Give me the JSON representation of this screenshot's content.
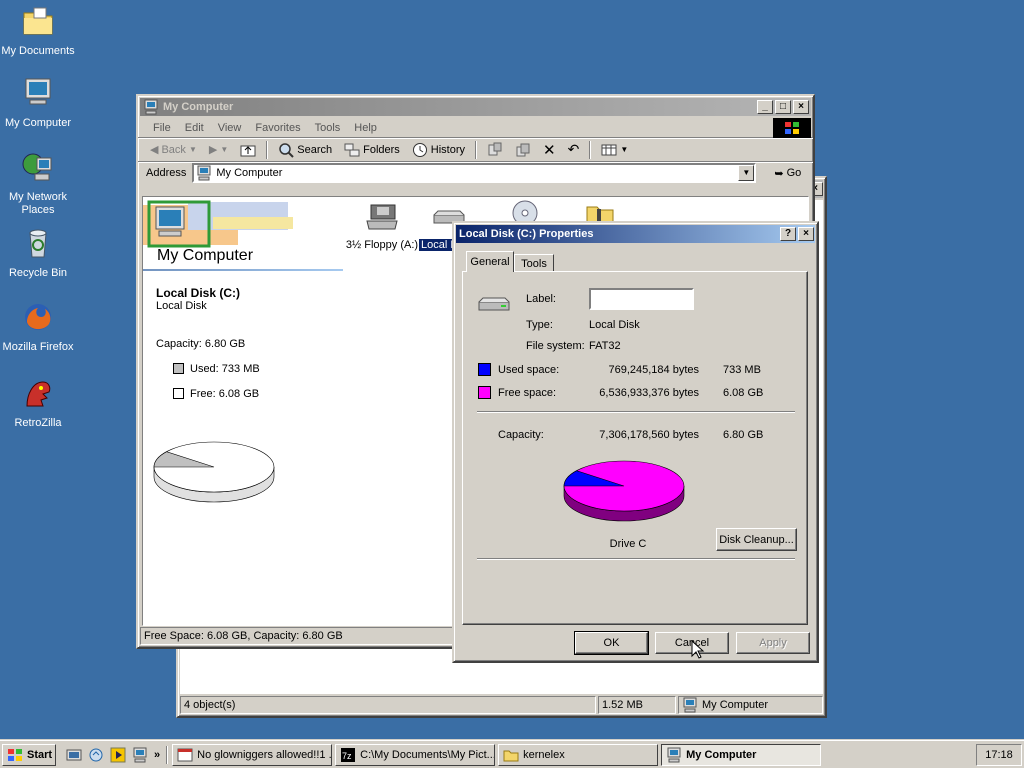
{
  "desktop": {
    "icons": [
      {
        "label": "My Documents"
      },
      {
        "label": "My Computer"
      },
      {
        "label": "My Network Places"
      },
      {
        "label": "Recycle Bin"
      },
      {
        "label": "Mozilla Firefox"
      },
      {
        "label": "RetroZilla"
      }
    ]
  },
  "explorer": {
    "title": "My Computer",
    "menu": [
      "File",
      "Edit",
      "View",
      "Favorites",
      "Tools",
      "Help"
    ],
    "toolbar": {
      "back": "Back",
      "search": "Search",
      "folders": "Folders",
      "history": "History"
    },
    "address_label": "Address",
    "address_value": "My Computer",
    "go": "Go",
    "side": {
      "heading": "My Computer",
      "drive_name": "Local Disk (C:)",
      "drive_type": "Local Disk",
      "capacity": "Capacity: 6.80 GB",
      "used": "Used: 733 MB",
      "free": "Free: 6.08 GB"
    },
    "items": [
      {
        "label": "3½ Floppy (A:)"
      },
      {
        "label": "Local D"
      }
    ],
    "status": "Free Space: 6.08 GB, Capacity: 6.80 GB"
  },
  "back_window": {
    "status": [
      "4 object(s)",
      "1.52 MB",
      "My Computer"
    ]
  },
  "dialog": {
    "title": "Local Disk (C:) Properties",
    "tabs": [
      "General",
      "Tools"
    ],
    "label_caption": "Label:",
    "label_value": "",
    "type_caption": "Type:",
    "type_value": "Local Disk",
    "fs_caption": "File system:",
    "fs_value": "FAT32",
    "used_caption": "Used space:",
    "used_bytes": "769,245,184 bytes",
    "used_size": "733 MB",
    "free_caption": "Free space:",
    "free_bytes": "6,536,933,376 bytes",
    "free_size": "6.08 GB",
    "capacity_caption": "Capacity:",
    "capacity_bytes": "7,306,178,560 bytes",
    "capacity_size": "6.80 GB",
    "drive_label": "Drive C",
    "cleanup": "Disk Cleanup...",
    "ok": "OK",
    "cancel": "Cancel",
    "apply": "Apply",
    "used_fraction": 0.105,
    "colors": {
      "used": "#0000ff",
      "free": "#ff00ff"
    }
  },
  "taskbar": {
    "start": "Start",
    "tasks": [
      {
        "label": "No glowniggers allowed!!1 ..."
      },
      {
        "label": "C:\\My Documents\\My Pict..."
      },
      {
        "label": "kernelex"
      },
      {
        "label": "My Computer"
      }
    ],
    "clock": "17:18"
  }
}
